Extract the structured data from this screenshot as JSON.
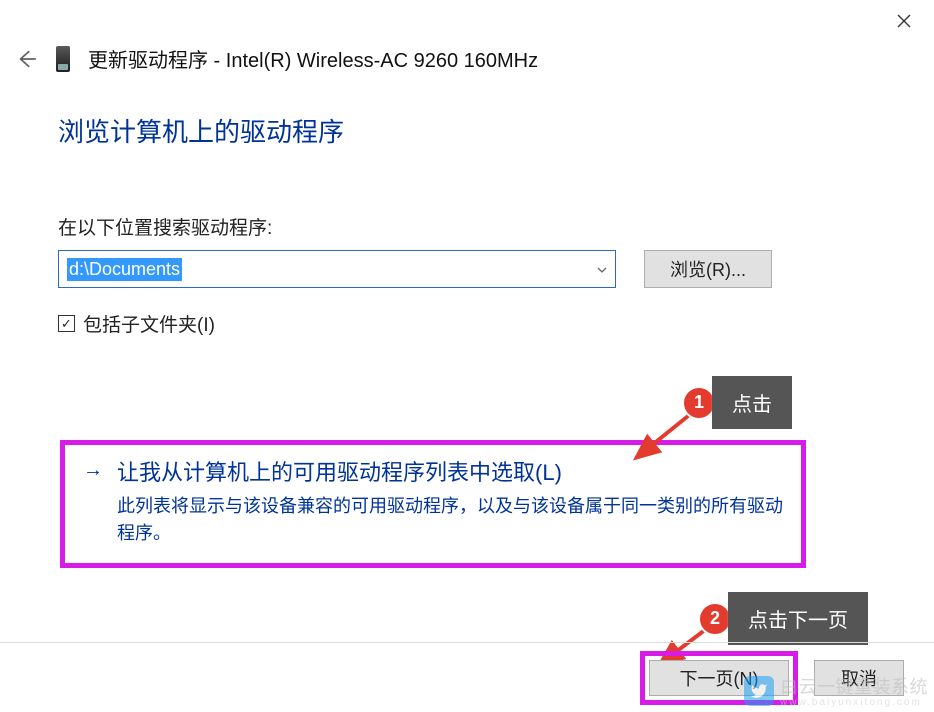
{
  "window": {
    "title_prefix": "更新驱动程序 - ",
    "device_name": "Intel(R) Wireless-AC 9260 160MHz"
  },
  "heading": "浏览计算机上的驱动程序",
  "search_label": "在以下位置搜索驱动程序:",
  "path_value": "d:\\Documents",
  "browse_button": "浏览(R)...",
  "include_subfolders": {
    "label": "包括子文件夹(I)",
    "checked": true
  },
  "option": {
    "title": "让我从计算机上的可用驱动程序列表中选取(L)",
    "desc": "此列表将显示与该设备兼容的可用驱动程序，以及与该设备属于同一类别的所有驱动程序。"
  },
  "footer": {
    "next": "下一页(N)",
    "cancel": "取消"
  },
  "annotations": {
    "a1_num": "1",
    "a1_text": "点击",
    "a2_num": "2",
    "a2_text": "点击下一页"
  },
  "watermark": {
    "text": "白云一键重装系统",
    "url": "www.baiyunxitong.com"
  }
}
